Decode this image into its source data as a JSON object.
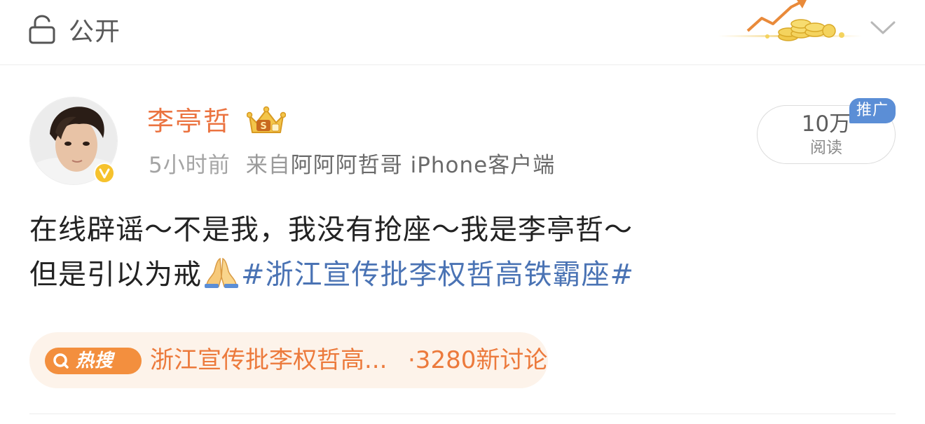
{
  "header": {
    "visibility_label": "公开",
    "visibility_icon": "lock-open-icon",
    "expand_icon": "chevron-down-icon"
  },
  "post": {
    "author": {
      "name": "李亭哲",
      "avatar": "avatar",
      "verified_icon": "verified-v-icon",
      "member_icon": "crown-icon"
    },
    "time": "5小时前",
    "source_prefix": "来自",
    "source": "阿阿阿哲哥 iPhone客户端",
    "read_count": "10万",
    "read_label": "阅读",
    "promo_badge": "推广",
    "content": {
      "line1": "在线辟谣～不是我，我没有抢座～我是李亭哲～",
      "line2_text": "但是引以为戒",
      "line2_emoji": "folded-hands-emoji",
      "hashtag": "#浙江宣传批李权哲高铁霸座#"
    },
    "hot_search": {
      "badge_label": "热搜",
      "badge_icon": "search-icon",
      "topic": "浙江宣传批李权哲高...",
      "count": "·3280新讨论"
    }
  },
  "colors": {
    "author_name": "#eb7340",
    "hashtag": "#4a73b4",
    "hot_badge": "#f38f3e",
    "hot_chip_bg": "#fdf3ea",
    "promo_badge": "#5b8ed6"
  }
}
